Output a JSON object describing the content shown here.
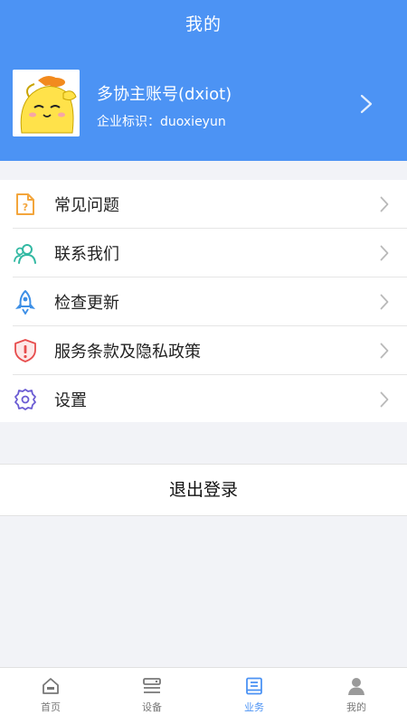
{
  "header": {
    "title": "我的",
    "background": "#4c93f4"
  },
  "profile": {
    "name": "多协主账号(dxiot)",
    "org_label": "企业标识：duoxieyun",
    "avatar_icon": "duck-avatar"
  },
  "menu": {
    "items": [
      {
        "label": "常见问题",
        "icon": "faq-document-icon",
        "color": "#f3a53b"
      },
      {
        "label": "联系我们",
        "icon": "contacts-icon",
        "color": "#33b9a3"
      },
      {
        "label": "检查更新",
        "icon": "rocket-icon",
        "color": "#3d8fe6"
      },
      {
        "label": "服务条款及隐私政策",
        "icon": "shield-alert-icon",
        "color": "#e74c4c"
      },
      {
        "label": "设置",
        "icon": "gear-icon",
        "color": "#6a5bd3"
      }
    ]
  },
  "logout": {
    "label": "退出登录"
  },
  "tabbar": {
    "tabs": [
      {
        "label": "首页",
        "icon": "home-icon"
      },
      {
        "label": "设备",
        "icon": "device-icon"
      },
      {
        "label": "业务",
        "icon": "business-book-icon",
        "active": true
      },
      {
        "label": "我的",
        "icon": "person-icon"
      }
    ],
    "active_color": "#4c93f4"
  }
}
